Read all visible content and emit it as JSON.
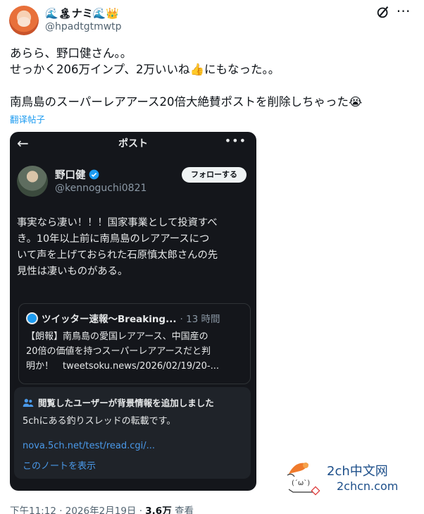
{
  "author": {
    "display_name": "🌊🏝ナミ🌊👑",
    "handle": "@hpadtgtmwtp"
  },
  "post": {
    "lines": [
      "あらら、野口健さん。。",
      "せっかく206万インプ、2万いいね👍にもなった。。",
      "",
      "南鳥島のスーパーレアアース20倍大絶賛ポストを削除しちゃった😭"
    ],
    "translate_label": "翻译帖子"
  },
  "screenshot": {
    "header_title": "ポスト",
    "quoted_author": {
      "name": "野口健",
      "handle": "@kennoguchi0821",
      "follow_label": "フォローする"
    },
    "quoted_text": [
      "事実なら凄い！！！国家事業として投資すべ",
      "き。10年以上前に南鳥島のレアアースにつ",
      "いて声を上げておられた石原慎太郎さんの先",
      "見性は凄いものがある。"
    ],
    "card": {
      "source": "ツイッター速報〜Breaking...",
      "time": "· 13 時間",
      "text": [
        "【朗報】南鳥島の愛国レアアース、中国産の",
        "20倍の価値を持つスーパーレアアースだと判",
        "明か！　tweetsoku.news/2026/02/19/20-..."
      ]
    },
    "note": {
      "header": "閲覧したユーザーが背景情報を追加しました",
      "body": "5chにある釣りスレッドの転載です。",
      "link": "nova.5ch.net/test/read.cgi/...",
      "show_label": "このノートを表示"
    }
  },
  "meta": {
    "time": "下午11:12 · 2026年2月19日 · ",
    "views": "3.6万",
    "views_label": " 查看"
  },
  "watermark": {
    "line1": "2ch中文网",
    "line2": "2chcn.com"
  },
  "colors": {
    "link_blue": "#1d9bf0",
    "dark_bg": "#14161b",
    "note_bg": "#1f2329",
    "verified_blue": "#1d9bf0"
  }
}
